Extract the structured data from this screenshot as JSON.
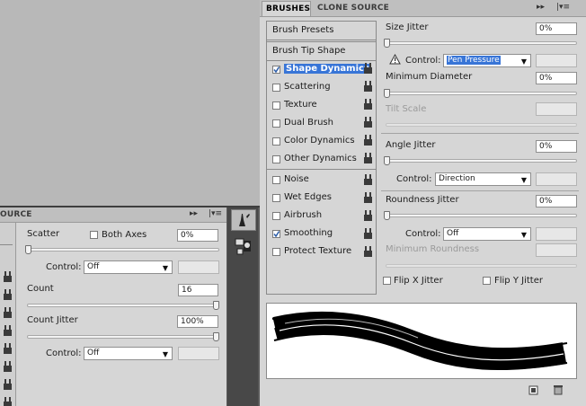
{
  "left_panel": {
    "tab_partial": "OURCE",
    "scatter": {
      "label": "Scatter",
      "both_axes": "Both Axes",
      "value": "0%",
      "level": 0
    },
    "control1": {
      "label": "Control:",
      "value": "Off"
    },
    "count": {
      "label": "Count",
      "value": "16",
      "level": 1
    },
    "count_jitter": {
      "label": "Count Jitter",
      "value": "100%",
      "level": 1
    },
    "control2": {
      "label": "Control:",
      "value": "Off"
    }
  },
  "brushes_panel": {
    "tabs": [
      "BRUSHES",
      "CLONE SOURCE"
    ],
    "brush_presets": "Brush Presets",
    "brush_tip_shape": "Brush Tip Shape",
    "options": [
      {
        "label": "Shape Dynamics",
        "checked": true,
        "selected": true
      },
      {
        "label": "Scattering",
        "checked": false
      },
      {
        "label": "Texture",
        "checked": false
      },
      {
        "label": "Dual Brush",
        "checked": false
      },
      {
        "label": "Color Dynamics",
        "checked": false
      },
      {
        "label": "Other Dynamics",
        "checked": false
      },
      {
        "label": "Noise",
        "checked": false
      },
      {
        "label": "Wet Edges",
        "checked": false
      },
      {
        "label": "Airbrush",
        "checked": false
      },
      {
        "label": "Smoothing",
        "checked": true
      },
      {
        "label": "Protect Texture",
        "checked": false
      }
    ],
    "size_jitter": {
      "label": "Size Jitter",
      "value": "0%",
      "level": 0
    },
    "control_size": {
      "label": "Control:",
      "value": "Pen Pressure"
    },
    "min_diameter": {
      "label": "Minimum Diameter",
      "value": "0%",
      "level": 0
    },
    "tilt_scale": {
      "label": "Tilt Scale"
    },
    "angle_jitter": {
      "label": "Angle Jitter",
      "value": "0%",
      "level": 0
    },
    "control_angle": {
      "label": "Control:",
      "value": "Direction"
    },
    "roundness_jitter": {
      "label": "Roundness Jitter",
      "value": "0%",
      "level": 0
    },
    "control_round": {
      "label": "Control:",
      "value": "Off"
    },
    "min_roundness": {
      "label": "Minimum Roundness"
    },
    "flip_x": "Flip X Jitter",
    "flip_y": "Flip Y Jitter"
  }
}
